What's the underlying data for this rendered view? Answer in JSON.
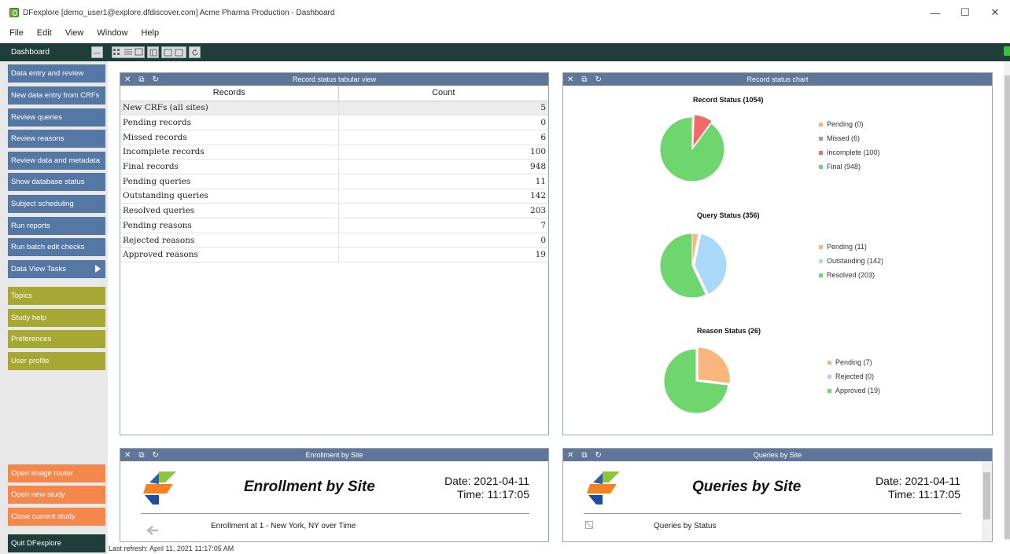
{
  "window": {
    "title": "DFexplore [demo_user1@explore.dfdiscover.com] Acme Pharma Production - Dashboard",
    "controls": [
      "—",
      "☐",
      "✕"
    ]
  },
  "menu": [
    "File",
    "Edit",
    "View",
    "Window",
    "Help"
  ],
  "toolbar": {
    "title": "Dashboard",
    "collapse_label": "—"
  },
  "sidebar": {
    "tasks": [
      "Data entry and review",
      "New data entry from CRFs",
      "Review  queries",
      "Review reasons",
      "Review data and metadata",
      "Show database status",
      "Subject scheduling",
      "Run reports",
      "Run batch edit checks",
      "Data View Tasks"
    ],
    "help": [
      "Topics",
      "Study help",
      "Preferences",
      "User profile"
    ],
    "study": [
      "Open image router",
      "Open new study",
      "Close current study"
    ],
    "quit": "Quit DFexplore"
  },
  "panel_icons": {
    "close": "✕",
    "detach": "⧉",
    "refresh": "↻"
  },
  "record_table": {
    "title": "Record status tabular view",
    "headers": [
      "Records",
      "Count"
    ],
    "rows": [
      {
        "label": "New CRFs (all sites)",
        "count": "5"
      },
      {
        "label": "Pending records",
        "count": "0"
      },
      {
        "label": "Missed records",
        "count": "6"
      },
      {
        "label": "Incomplete records",
        "count": "100"
      },
      {
        "label": "Final records",
        "count": "948"
      },
      {
        "label": "Pending queries",
        "count": "11"
      },
      {
        "label": "Outstanding queries",
        "count": "142"
      },
      {
        "label": "Resolved queries",
        "count": "203"
      },
      {
        "label": "Pending reasons",
        "count": "7"
      },
      {
        "label": "Rejected reasons",
        "count": "0"
      },
      {
        "label": "Approved reasons",
        "count": "19"
      }
    ]
  },
  "chart_panel": {
    "title": "Record status chart"
  },
  "chart_data": [
    {
      "type": "pie",
      "title": "Record Status (1054)",
      "categories": [
        "Pending (0)",
        "Missed (6)",
        "Incomplete (100)",
        "Final (948)"
      ],
      "values": [
        0,
        6,
        100,
        948
      ],
      "colors": [
        "#f8b67c",
        "#9e9e9e",
        "#f06a6a",
        "#6fd66f"
      ],
      "legend": "right"
    },
    {
      "type": "pie",
      "title": "Query Status (356)",
      "categories": [
        "Pending (11)",
        "Outstanding (142)",
        "Resolved (203)"
      ],
      "values": [
        11,
        142,
        203
      ],
      "colors": [
        "#f8b67c",
        "#aad8f8",
        "#6fd66f"
      ],
      "legend": "right"
    },
    {
      "type": "pie",
      "title": "Reason Status (26)",
      "categories": [
        "Pending (7)",
        "Rejected (0)",
        "Approved (19)"
      ],
      "values": [
        7,
        0,
        19
      ],
      "colors": [
        "#f8b67c",
        "#aad8f8",
        "#6fd66f"
      ],
      "legend": "right"
    }
  ],
  "enrollment": {
    "panel_title": "Enrollment by Site",
    "heading": "Enrollment by Site",
    "date": "Date: 2021-04-11",
    "time": "Time: 11:17:05",
    "subtitle": "Enrollment at 1 - New York, NY over Time"
  },
  "queries": {
    "panel_title": "Queries by Site",
    "heading": "Queries by Site",
    "date": "Date: 2021-04-11",
    "time": "Time: 11:17:05",
    "subtitle": "Queries by Status"
  },
  "status": "Last refresh: April 11, 2021 11:17:05 AM"
}
